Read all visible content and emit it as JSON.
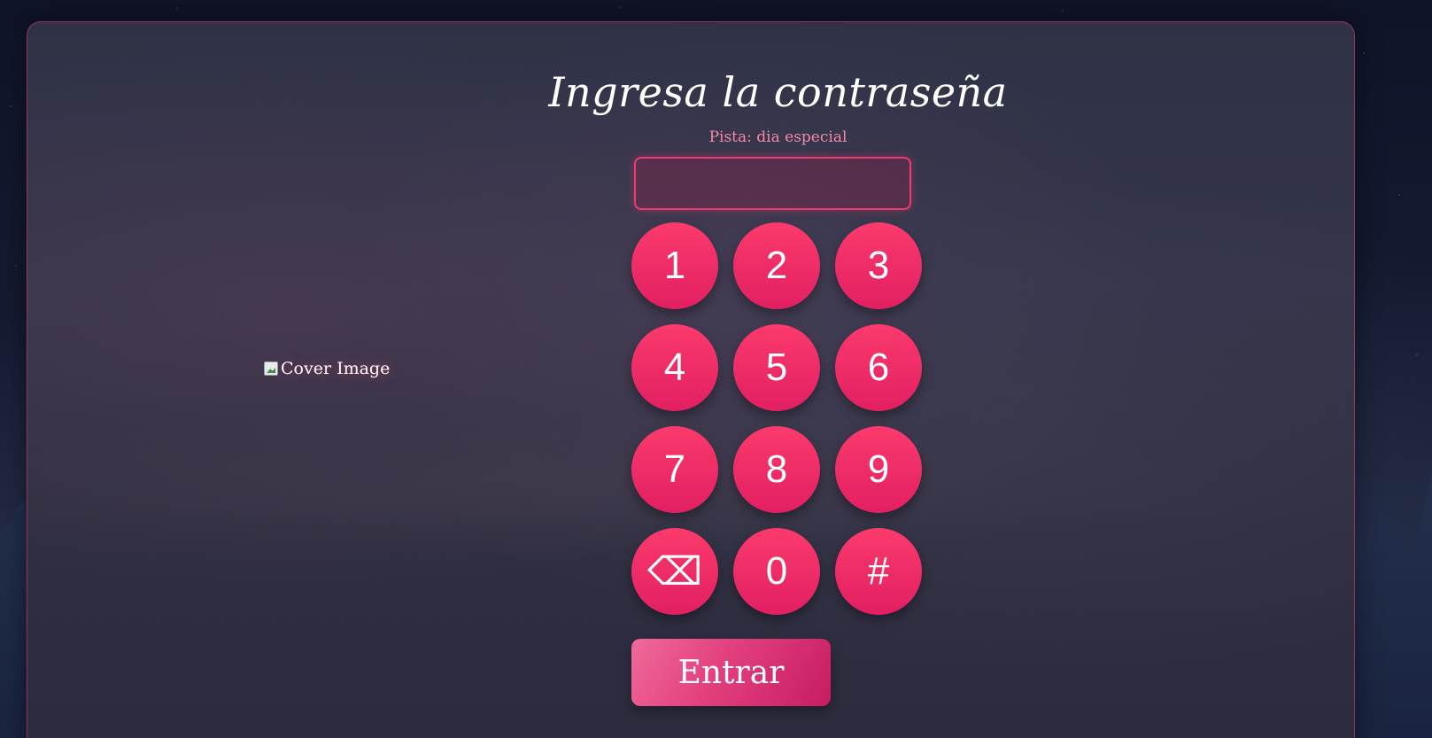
{
  "page": {
    "title": "Ingresa la contraseña",
    "hint": "Pista: dia especial"
  },
  "cover": {
    "alt_text": "Cover Image",
    "icon": "broken-image-icon"
  },
  "password_input": {
    "value": "",
    "placeholder": ""
  },
  "keypad": {
    "keys": [
      "1",
      "2",
      "3",
      "4",
      "5",
      "6",
      "7",
      "8",
      "9",
      "⌫",
      "0",
      "#"
    ],
    "backspace_icon": "backspace-icon"
  },
  "enter_button": {
    "label": "Entrar"
  },
  "colors": {
    "accent": "#f03a6d",
    "hint_text": "#f389a8",
    "key_gradient_top": "#fb3a6c",
    "key_gradient_bottom": "#e21f62"
  }
}
